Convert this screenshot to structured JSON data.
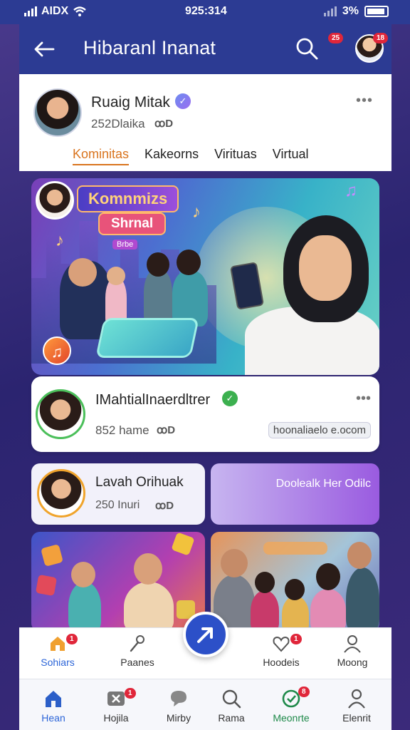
{
  "status_bar": {
    "carrier": "AIDX",
    "time": "925:314",
    "battery_text": "3%"
  },
  "app_bar": {
    "title": "Hibaranl Inanat",
    "search_badge": "25",
    "avatar_badge": "18"
  },
  "profile": {
    "name": "Ruaig Mitak",
    "subtitle": "252Dlaika",
    "mini_icons": "ꝏD",
    "tabs": [
      {
        "label": "Kominitas",
        "active": true
      },
      {
        "label": "Kakeorns",
        "active": false
      },
      {
        "label": "Virituas",
        "active": false
      },
      {
        "label": "Virtual",
        "active": false
      }
    ]
  },
  "hero": {
    "sign_top": "Komnmizs",
    "sign_middle": "Shrnal",
    "sign_small": "Brbe"
  },
  "post": {
    "name": "IMahtialInaerdltrer",
    "subtitle": "852 hame",
    "mini_icons": "ꝏD",
    "link": "hoonaliaelo e.ocom"
  },
  "small_card": {
    "name": "Lavah Orihuak",
    "subtitle": "250 Inuri",
    "mini_icons": "ꝏD"
  },
  "gradient_card": {
    "text": "Doolealk Her Odilc"
  },
  "bottom_nav": {
    "items": [
      {
        "label": "Sohiars",
        "badge": "1",
        "active": true
      },
      {
        "label": "Paanes",
        "badge": "",
        "active": false
      },
      {
        "label": "Hoodeis",
        "badge": "1",
        "active": false
      },
      {
        "label": "Moong",
        "badge": "",
        "active": false
      }
    ]
  },
  "tab_bar": {
    "items": [
      {
        "label": "Hean",
        "badge": "",
        "active": true
      },
      {
        "label": "Hojila",
        "badge": "1",
        "active": false
      },
      {
        "label": "Mirby",
        "badge": "",
        "active": false
      },
      {
        "label": "Rama",
        "badge": "",
        "active": false
      },
      {
        "label": "Meonrte",
        "badge": "8",
        "active": false
      },
      {
        "label": "Elenrit",
        "badge": "",
        "active": false
      }
    ]
  },
  "colors": {
    "primary": "#2c3b93",
    "accent_orange": "#d9741e",
    "badge_red": "#e0263a",
    "verified_green": "#3cb04f",
    "active_blue": "#2c65d8"
  }
}
